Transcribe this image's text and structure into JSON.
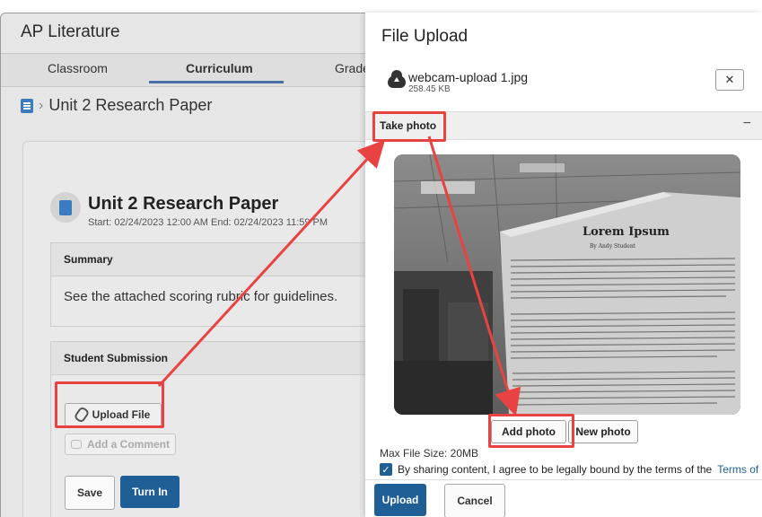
{
  "app": {
    "title": "AP Literature",
    "tabs": [
      {
        "label": "Classroom"
      },
      {
        "label": "Curriculum"
      },
      {
        "label": "Grade"
      }
    ],
    "breadcrumb": {
      "label": "Unit 2 Research Paper"
    }
  },
  "assignment": {
    "title": "Unit 2 Research Paper",
    "dates": "Start: 02/24/2023 12:00 AM  End: 02/24/2023 11:59 PM",
    "summary_heading": "Summary",
    "summary_text": "See the attached scoring rubric for guidelines.",
    "submission_heading": "Student Submission",
    "upload_file_label": "Upload File",
    "add_comment_label": "Add a Comment",
    "save_label": "Save",
    "turn_in_label": "Turn In"
  },
  "upload_panel": {
    "title": "File Upload",
    "file": {
      "name": "webcam-upload 1.jpg",
      "size": "258.45 KB"
    },
    "close_label": "✕",
    "take_photo_label": "Take photo",
    "collapse_label": "−",
    "photo_doc": {
      "heading": "Lorem Ipsum",
      "byline": "By Andy Student"
    },
    "add_photo_label": "Add photo",
    "new_photo_label": "New photo",
    "max_size": "Max File Size: 20MB",
    "terms_text": "By sharing content, I agree to be legally bound by the terms of the",
    "terms_link": "Terms of",
    "upload_label": "Upload",
    "cancel_label": "Cancel"
  },
  "colors": {
    "primary": "#1f5f96",
    "highlight": "#e94242",
    "link": "#1f5f96"
  }
}
